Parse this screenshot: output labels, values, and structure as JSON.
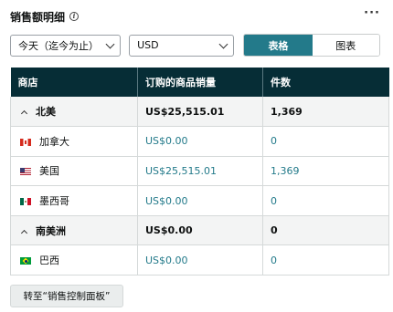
{
  "header": {
    "title": "销售额明细",
    "info_icon": "i",
    "more_icon": "···"
  },
  "controls": {
    "date_range": "今天（迄今为止）",
    "currency": "USD",
    "view_toggle": {
      "table_label": "表格",
      "chart_label": "图表",
      "active": "table"
    }
  },
  "table": {
    "columns": [
      "商店",
      "订购的商品销量",
      "件数"
    ],
    "rows": [
      {
        "type": "region",
        "name": "北美",
        "sales": "US$25,515.01",
        "units": "1,369"
      },
      {
        "type": "country",
        "flag": "flag-ca",
        "name": "加拿大",
        "sales": "US$0.00",
        "units": "0"
      },
      {
        "type": "country",
        "flag": "flag-us",
        "name": "美国",
        "sales": "US$25,515.01",
        "units": "1,369"
      },
      {
        "type": "country",
        "flag": "flag-mx",
        "name": "墨西哥",
        "sales": "US$0.00",
        "units": "0"
      },
      {
        "type": "region",
        "name": "南美洲",
        "sales": "US$0.00",
        "units": "0"
      },
      {
        "type": "country",
        "flag": "flag-br",
        "name": "巴西",
        "sales": "US$0.00",
        "units": "0"
      }
    ]
  },
  "footer": {
    "button_label": "转至“销售控制面板”"
  },
  "colors": {
    "accent": "#237a8a",
    "header_bg": "#062d36",
    "region_bg": "#f3f4f4"
  }
}
